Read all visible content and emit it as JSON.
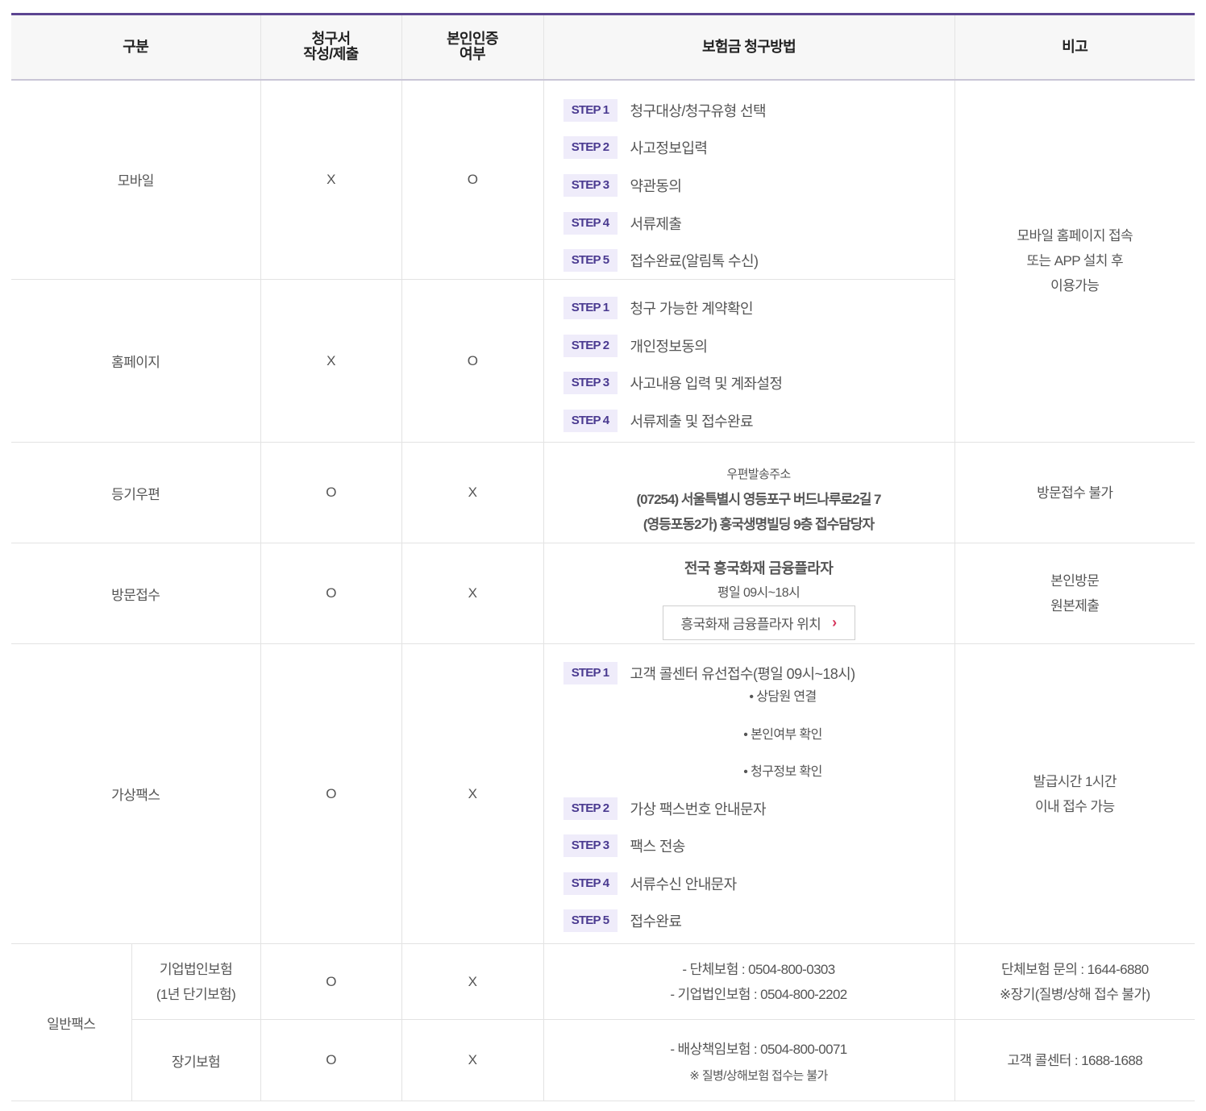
{
  "headers": {
    "category": "구분",
    "claim_form_line1": "청구서",
    "claim_form_line2": "작성/제출",
    "identity_line1": "본인인증",
    "identity_line2": "여부",
    "method": "보험금 청구방법",
    "remarks": "비고"
  },
  "rows": {
    "mobile": {
      "category": "모바일",
      "form": "X",
      "identity": "O",
      "steps": [
        {
          "badge": "STEP 1",
          "text": "청구대상/청구유형 선택"
        },
        {
          "badge": "STEP 2",
          "text": "사고정보입력"
        },
        {
          "badge": "STEP 3",
          "text": "약관동의"
        },
        {
          "badge": "STEP 4",
          "text": "서류제출"
        },
        {
          "badge": "STEP 5",
          "text": "접수완료(알림톡 수신)"
        }
      ]
    },
    "online_remark": {
      "line1": "모바일 홈페이지 접속",
      "line2": "또는 APP 설치 후",
      "line3": "이용가능"
    },
    "homepage": {
      "category": "홈페이지",
      "form": "X",
      "identity": "O",
      "steps": [
        {
          "badge": "STEP 1",
          "text": "청구 가능한 계약확인"
        },
        {
          "badge": "STEP 2",
          "text": "개인정보동의"
        },
        {
          "badge": "STEP 3",
          "text": "사고내용 입력 및 계좌설정"
        },
        {
          "badge": "STEP 4",
          "text": "서류제출 및 접수완료"
        }
      ]
    },
    "mail": {
      "category": "등기우편",
      "form": "O",
      "identity": "X",
      "address_label": "우편발송주소",
      "address_line1": "(07254) 서울특별시 영등포구 버드나루로2길 7",
      "address_line2": "(영등포동2가) 흥국생명빌딩 9층 접수담당자",
      "remark": "방문접수 불가"
    },
    "visit": {
      "category": "방문접수",
      "form": "O",
      "identity": "X",
      "plaza_title": "전국 흥국화재 금융플라자",
      "plaza_hours": "평일 09시~18시",
      "plaza_button": "흥국화재 금융플라자 위치",
      "remark_line1": "본인방문",
      "remark_line2": "원본제출"
    },
    "virtual_fax": {
      "category": "가상팩스",
      "form": "O",
      "identity": "X",
      "step1": {
        "badge": "STEP 1",
        "text": "고객 콜센터 유선접수(평일 09시~18시)"
      },
      "substeps": [
        "• 상담원 연결",
        "• 본인여부 확인",
        "• 청구정보 확인"
      ],
      "steps": [
        {
          "badge": "STEP 2",
          "text": "가상 팩스번호 안내문자"
        },
        {
          "badge": "STEP 3",
          "text": "팩스 전송"
        },
        {
          "badge": "STEP 4",
          "text": "서류수신 안내문자"
        },
        {
          "badge": "STEP 5",
          "text": "접수완료"
        }
      ],
      "remark_line1": "발급시간 1시간",
      "remark_line2": "이내 접수 가능"
    },
    "general_fax": {
      "category": "일반팩스",
      "corporate": {
        "name_line1": "기업법인보험",
        "name_line2": "(1년 단기보험)",
        "form": "O",
        "identity": "X",
        "line1": "- 단체보험 : 0504-800-0303",
        "line2": "- 기업법인보험 : 0504-800-2202",
        "remark_line1": "단체보험 문의 : 1644-6880",
        "remark_line2": "※장기(질병/상해 접수 불가)"
      },
      "longterm": {
        "name": "장기보험",
        "form": "O",
        "identity": "X",
        "line1": "- 배상책임보험 : 0504-800-0071",
        "note": "※ 질병/상해보험 접수는 불가",
        "remark": "고객 콜센터 : 1688-1688"
      }
    }
  }
}
